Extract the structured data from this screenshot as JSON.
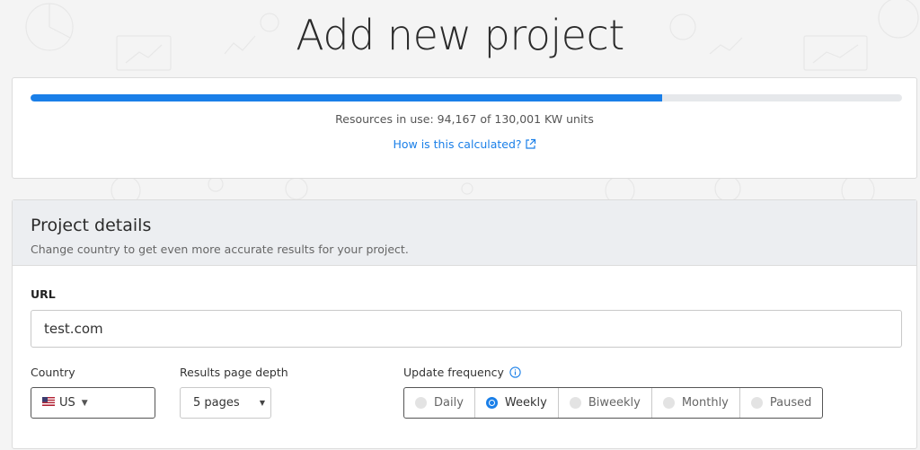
{
  "page": {
    "title": "Add new project"
  },
  "usage": {
    "progress": 0.7243,
    "text": "Resources in use: 94,167 of 130,001 KW units",
    "link_label": "How is this calculated?",
    "accent_color": "#1a7fe8"
  },
  "details": {
    "title": "Project details",
    "subtitle": "Change country to get even more accurate results for your project.",
    "url": {
      "label": "URL",
      "value": "test.com"
    },
    "country": {
      "label": "Country",
      "value": "US",
      "flag": "us-flag-icon"
    },
    "depth": {
      "label": "Results page depth",
      "value": "5 pages"
    },
    "frequency": {
      "label": "Update frequency",
      "selected": "Weekly",
      "options": [
        {
          "label": "Daily"
        },
        {
          "label": "Weekly"
        },
        {
          "label": "Biweekly"
        },
        {
          "label": "Monthly"
        },
        {
          "label": "Paused"
        }
      ]
    }
  }
}
